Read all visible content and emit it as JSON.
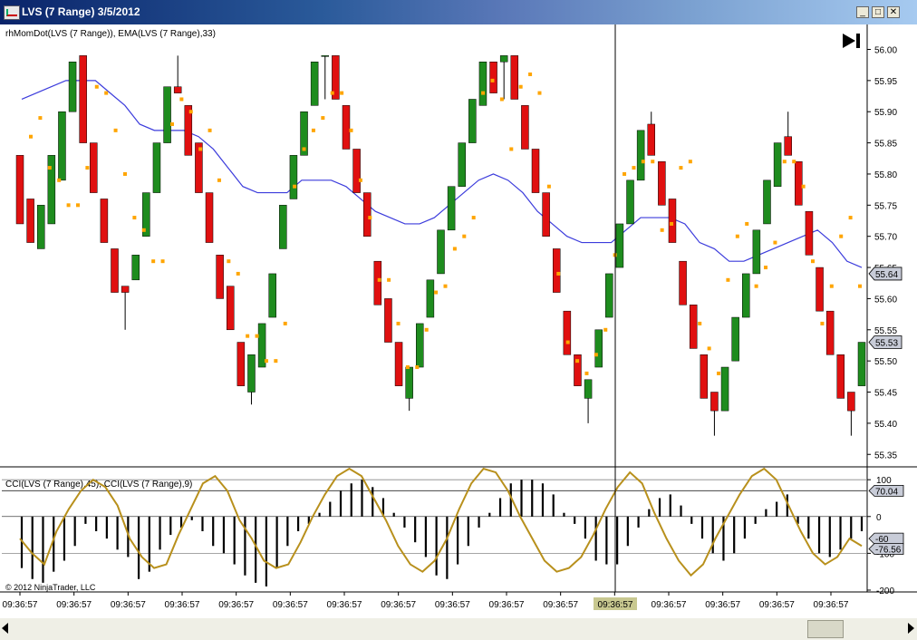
{
  "window": {
    "title": "LVS (7 Range)  3/5/2012",
    "min_label": "_",
    "max_label": "□",
    "close_label": "✕"
  },
  "chart_data": [
    {
      "type": "candlestick",
      "title": "rhMomDot(LVS (7 Range)), EMA(LVS (7 Range),33)",
      "ylim": [
        55.33,
        56.04
      ],
      "yticks": [
        "56.00",
        "55.95",
        "55.90",
        "55.85",
        "55.80",
        "55.75",
        "55.70",
        "55.65",
        "55.60",
        "55.55",
        "55.50",
        "55.45",
        "55.40",
        "55.35"
      ],
      "last_price_labels": [
        {
          "text": "55.64",
          "value": 55.64
        },
        {
          "text": "55.53",
          "value": 55.53
        }
      ],
      "candles": [
        [
          55.83,
          55.83,
          55.72,
          55.72
        ],
        [
          55.76,
          55.76,
          55.69,
          55.69
        ],
        [
          55.68,
          55.75,
          55.68,
          55.75
        ],
        [
          55.72,
          55.83,
          55.72,
          55.83
        ],
        [
          55.79,
          55.9,
          55.79,
          55.9
        ],
        [
          55.9,
          55.98,
          55.9,
          55.98
        ],
        [
          55.99,
          55.99,
          55.85,
          55.85
        ],
        [
          55.85,
          55.85,
          55.77,
          55.77
        ],
        [
          55.76,
          55.76,
          55.69,
          55.69
        ],
        [
          55.68,
          55.68,
          55.61,
          55.61
        ],
        [
          55.62,
          55.62,
          55.55,
          55.61
        ],
        [
          55.63,
          55.67,
          55.63,
          55.67
        ],
        [
          55.7,
          55.77,
          55.7,
          55.77
        ],
        [
          55.77,
          55.85,
          55.77,
          55.85
        ],
        [
          55.85,
          55.94,
          55.85,
          55.94
        ],
        [
          55.94,
          55.99,
          55.93,
          55.93
        ],
        [
          55.91,
          55.91,
          55.83,
          55.83
        ],
        [
          55.85,
          55.85,
          55.77,
          55.77
        ],
        [
          55.77,
          55.77,
          55.69,
          55.69
        ],
        [
          55.67,
          55.67,
          55.6,
          55.6
        ],
        [
          55.62,
          55.62,
          55.55,
          55.55
        ],
        [
          55.53,
          55.53,
          55.46,
          55.46
        ],
        [
          55.45,
          55.51,
          55.43,
          55.51
        ],
        [
          55.49,
          55.56,
          55.49,
          55.56
        ],
        [
          55.57,
          55.64,
          55.57,
          55.64
        ],
        [
          55.68,
          55.75,
          55.68,
          55.75
        ],
        [
          55.76,
          55.83,
          55.76,
          55.83
        ],
        [
          55.83,
          55.9,
          55.83,
          55.9
        ],
        [
          55.91,
          55.98,
          55.91,
          55.98
        ],
        [
          55.99,
          55.99,
          55.92,
          55.99
        ],
        [
          55.99,
          55.99,
          55.92,
          55.92
        ],
        [
          55.91,
          55.91,
          55.84,
          55.84
        ],
        [
          55.84,
          55.84,
          55.77,
          55.77
        ],
        [
          55.77,
          55.77,
          55.7,
          55.7
        ],
        [
          55.66,
          55.66,
          55.59,
          55.59
        ],
        [
          55.6,
          55.6,
          55.53,
          55.53
        ],
        [
          55.53,
          55.53,
          55.46,
          55.46
        ],
        [
          55.44,
          55.49,
          55.42,
          55.49
        ],
        [
          55.49,
          55.56,
          55.49,
          55.56
        ],
        [
          55.57,
          55.63,
          55.57,
          55.63
        ],
        [
          55.64,
          55.71,
          55.64,
          55.71
        ],
        [
          55.71,
          55.78,
          55.71,
          55.78
        ],
        [
          55.78,
          55.85,
          55.78,
          55.85
        ],
        [
          55.85,
          55.92,
          55.85,
          55.92
        ],
        [
          55.91,
          55.98,
          55.91,
          55.98
        ],
        [
          55.98,
          55.98,
          55.93,
          55.93
        ],
        [
          55.98,
          55.99,
          55.92,
          55.99
        ],
        [
          55.99,
          55.99,
          55.92,
          55.92
        ],
        [
          55.91,
          55.91,
          55.84,
          55.84
        ],
        [
          55.84,
          55.84,
          55.77,
          55.77
        ],
        [
          55.77,
          55.77,
          55.7,
          55.7
        ],
        [
          55.68,
          55.68,
          55.61,
          55.61
        ],
        [
          55.58,
          55.58,
          55.51,
          55.51
        ],
        [
          55.51,
          55.51,
          55.46,
          55.46
        ],
        [
          55.44,
          55.47,
          55.4,
          55.47
        ],
        [
          55.49,
          55.55,
          55.49,
          55.55
        ],
        [
          55.57,
          55.64,
          55.57,
          55.64
        ],
        [
          55.65,
          55.72,
          55.65,
          55.72
        ],
        [
          55.72,
          55.79,
          55.72,
          55.79
        ],
        [
          55.79,
          55.87,
          55.79,
          55.87
        ],
        [
          55.88,
          55.9,
          55.83,
          55.83
        ],
        [
          55.82,
          55.82,
          55.75,
          55.75
        ],
        [
          55.76,
          55.76,
          55.69,
          55.69
        ],
        [
          55.66,
          55.66,
          55.59,
          55.59
        ],
        [
          55.59,
          55.59,
          55.52,
          55.52
        ],
        [
          55.51,
          55.51,
          55.44,
          55.44
        ],
        [
          55.45,
          55.45,
          55.38,
          55.42
        ],
        [
          55.42,
          55.49,
          55.42,
          55.49
        ],
        [
          55.5,
          55.57,
          55.5,
          55.57
        ],
        [
          55.57,
          55.64,
          55.57,
          55.64
        ],
        [
          55.64,
          55.71,
          55.64,
          55.71
        ],
        [
          55.72,
          55.79,
          55.72,
          55.79
        ],
        [
          55.78,
          55.85,
          55.78,
          55.85
        ],
        [
          55.86,
          55.9,
          55.83,
          55.83
        ],
        [
          55.82,
          55.82,
          55.75,
          55.75
        ],
        [
          55.74,
          55.74,
          55.67,
          55.67
        ],
        [
          55.65,
          55.65,
          55.58,
          55.58
        ],
        [
          55.58,
          55.58,
          55.51,
          55.51
        ],
        [
          55.51,
          55.51,
          55.44,
          55.44
        ],
        [
          55.45,
          55.45,
          55.38,
          55.42
        ],
        [
          55.46,
          55.53,
          55.46,
          55.53
        ]
      ],
      "dots": [
        55.86,
        55.89,
        55.81,
        55.79,
        55.75,
        55.75,
        55.81,
        55.94,
        55.93,
        55.87,
        55.8,
        55.73,
        55.71,
        55.66,
        55.66,
        55.88,
        55.92,
        55.9,
        55.84,
        55.87,
        55.79,
        55.66,
        55.64,
        55.54,
        55.54,
        55.5,
        55.5,
        55.56,
        55.78,
        55.84,
        55.87,
        55.89,
        55.93,
        55.93,
        55.87,
        55.79,
        55.73,
        55.63,
        55.63,
        55.56,
        55.49,
        55.49,
        55.55,
        55.61,
        55.62,
        55.68,
        55.7,
        55.73,
        55.93,
        55.95,
        55.92,
        55.84,
        55.94,
        55.96,
        55.93,
        55.78,
        55.64,
        55.53,
        55.5,
        55.48,
        55.51,
        55.55,
        55.67,
        55.8,
        55.81,
        55.82,
        55.82,
        55.71,
        55.72,
        55.81,
        55.82,
        55.56,
        55.52,
        55.48,
        55.63,
        55.7,
        55.72,
        55.62,
        55.65,
        55.69,
        55.82,
        55.82,
        55.78,
        55.66,
        55.56,
        55.62,
        55.7,
        55.73,
        55.62
      ],
      "ema": [
        55.92,
        55.93,
        55.94,
        55.95,
        55.95,
        55.95,
        55.93,
        55.91,
        55.88,
        55.87,
        55.87,
        55.87,
        55.86,
        55.84,
        55.81,
        55.78,
        55.77,
        55.77,
        55.77,
        55.79,
        55.79,
        55.79,
        55.78,
        55.76,
        55.74,
        55.73,
        55.72,
        55.72,
        55.73,
        55.75,
        55.77,
        55.79,
        55.8,
        55.79,
        55.77,
        55.74,
        55.72,
        55.7,
        55.69,
        55.69,
        55.69,
        55.71,
        55.73,
        55.73,
        55.73,
        55.72,
        55.69,
        55.68,
        55.66,
        55.66,
        55.67,
        55.68,
        55.69,
        55.7,
        55.71,
        55.69,
        55.66,
        55.65
      ],
      "grid": false,
      "legend": "none"
    },
    {
      "type": "bar+line",
      "title": "CCI(LVS (7 Range),45), CCI(LVS (7 Range),9)",
      "ylim": [
        -205,
        130
      ],
      "yticks": [
        "100",
        "0",
        "-100",
        "-200"
      ],
      "reference_levels": [
        100,
        70,
        0,
        -100
      ],
      "last_value_labels": [
        {
          "text": "70.04",
          "value": 70
        },
        {
          "text": "-60",
          "value": -60
        },
        {
          "text": "-76.56",
          "value": -88
        }
      ],
      "cci45": [
        -140,
        -170,
        -180,
        -150,
        -120,
        -80,
        -20,
        -40,
        -60,
        -90,
        -110,
        -170,
        -150,
        -90,
        -50,
        -30,
        -10,
        -40,
        -80,
        -100,
        -130,
        -160,
        -180,
        -190,
        -140,
        -80,
        -40,
        -20,
        10,
        40,
        70,
        90,
        100,
        80,
        50,
        10,
        -30,
        -70,
        -110,
        -160,
        -170,
        -130,
        -80,
        -30,
        10,
        50,
        90,
        100,
        100,
        90,
        60,
        10,
        -20,
        -60,
        -120,
        -130,
        -130,
        -80,
        -30,
        20,
        50,
        60,
        30,
        -20,
        -60,
        -100,
        -120,
        -100,
        -60,
        -20,
        20,
        40,
        60,
        -20,
        -60,
        -100,
        -110,
        -90,
        -60,
        -40
      ],
      "cci9": [
        -60,
        -100,
        -130,
        -40,
        20,
        70,
        100,
        80,
        30,
        -60,
        -110,
        -140,
        -130,
        -50,
        20,
        90,
        110,
        70,
        -10,
        -60,
        -120,
        -140,
        -130,
        -70,
        0,
        60,
        110,
        130,
        110,
        50,
        -10,
        -80,
        -130,
        -150,
        -120,
        -60,
        20,
        90,
        130,
        120,
        70,
        0,
        -60,
        -120,
        -150,
        -140,
        -110,
        -50,
        20,
        80,
        120,
        90,
        10,
        -60,
        -120,
        -160,
        -130,
        -60,
        0,
        60,
        110,
        130,
        100,
        30,
        -40,
        -100,
        -130,
        -110,
        -60,
        -80
      ],
      "grid": false,
      "legend": "none"
    }
  ],
  "x_axis": {
    "tick_labels": [
      "09:36:57",
      "09:36:57",
      "09:36:57",
      "09:36:57",
      "09:36:57",
      "09:36:57",
      "09:36:57",
      "09:36:57",
      "09:36:57",
      "09:36:57",
      "09:36:57",
      "09:36:57",
      "09:36:57",
      "09:36:57",
      "09:36:57",
      "09:36:57"
    ],
    "crosshair_label": "09:36:57"
  },
  "copyright": "© 2012 NinjaTrader, LLC",
  "colors": {
    "up": "#1e8c1e",
    "down": "#e01010",
    "dot": "#ffa500",
    "ema": "#3c3cdc",
    "cci9": "#b8901c",
    "cci45": "#000000",
    "crosshair_label_bg": "#c8c890"
  },
  "icons": {
    "play_to_end": "skip-to-end-icon"
  }
}
